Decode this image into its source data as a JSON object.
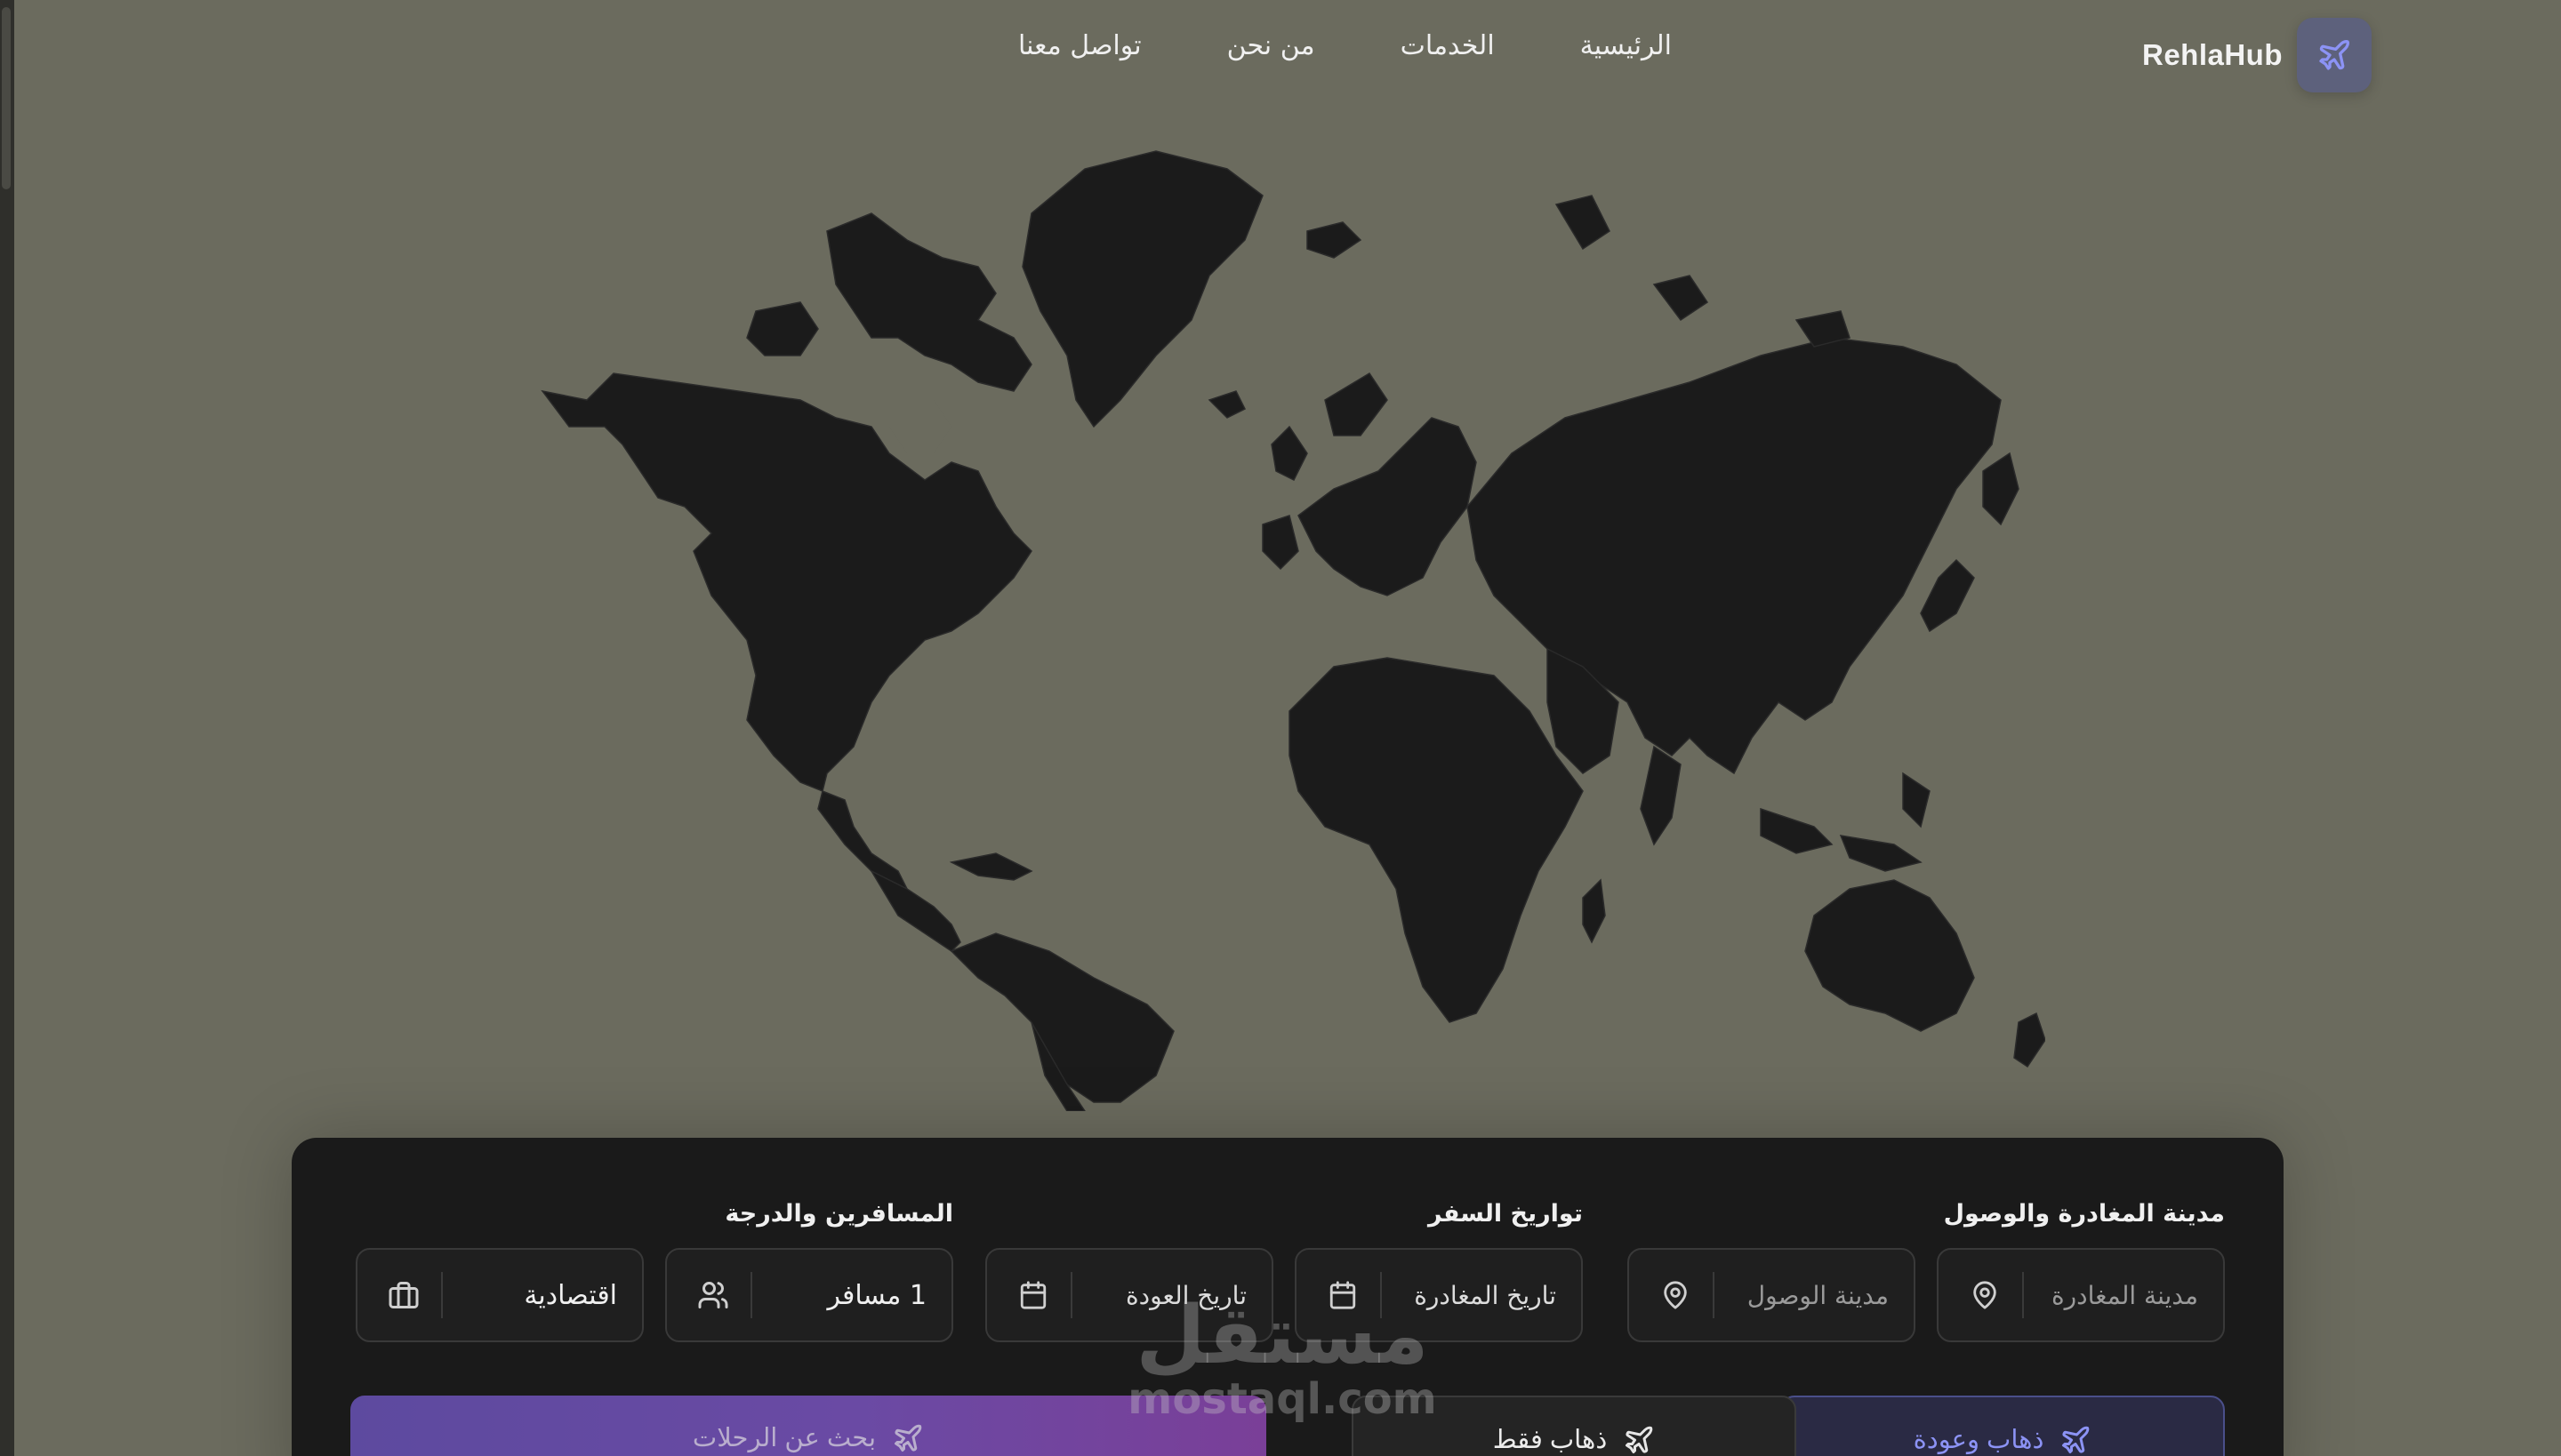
{
  "brand": {
    "name": "RehlaHub",
    "icon": "plane-icon"
  },
  "nav": {
    "items": [
      {
        "label": "الرئيسية"
      },
      {
        "label": "الخدمات"
      },
      {
        "label": "من نحن"
      },
      {
        "label": "تواصل معنا"
      }
    ]
  },
  "search": {
    "route_label": "مدينة المغادرة والوصول",
    "dates_label": "تواريخ السفر",
    "passengers_label": "المسافرين والدرجة",
    "from_placeholder": "مدينة المغادرة",
    "to_placeholder": "مدينة الوصول",
    "depart_placeholder": "تاريخ المغادرة",
    "return_placeholder": "تاريخ العودة",
    "passengers_value": "1 مسافر",
    "class_value": "اقتصادية",
    "round_trip_label": "ذهاب وعودة",
    "one_way_label": "ذهاب فقط",
    "search_button_label": "بحث عن الرحلات"
  },
  "watermark": {
    "arabic": "مستقل",
    "latin": "mostaql.com"
  },
  "colors": {
    "background": "#6b6b5e",
    "land": "#1b1b1b",
    "card": "#1a1a1a",
    "accent": "#8c93f5",
    "brand_badge": "#5d617c",
    "search_gradient_start": "#5d4a9f",
    "search_gradient_end": "#7a3f98"
  }
}
